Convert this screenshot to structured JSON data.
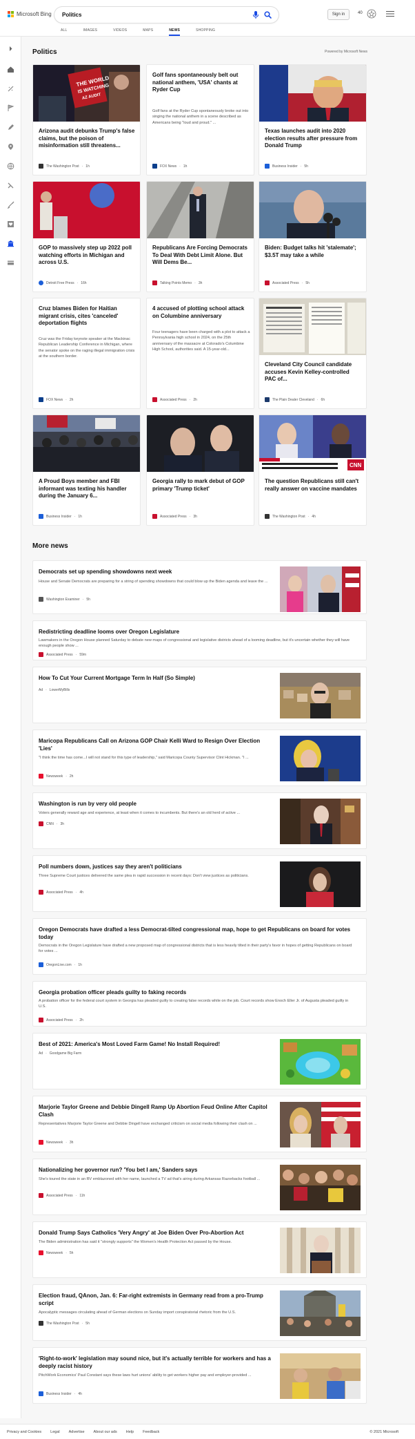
{
  "header": {
    "logo_text": "Microsoft Bing",
    "search_query": "Politics",
    "signin_label": "Sign in",
    "points": "40",
    "tabs": [
      "ALL",
      "IMAGES",
      "VIDEOS",
      "MAPS",
      "NEWS",
      "SHOPPING"
    ],
    "active_tab": "NEWS",
    "brand_colors": [
      "#f25022",
      "#7fba00",
      "#00a4ef",
      "#ffb900"
    ],
    "accent": "#174ae4"
  },
  "politics": {
    "title": "Politics",
    "powered_by": "Powered by Microsoft News",
    "cards": [
      {
        "title": "Arizona audit debunks Trump's false claims, but the poison of misinformation still threatens...",
        "source": "The Washington Post",
        "time": "1h",
        "summary": "",
        "image": "protest-sign"
      },
      {
        "title": "Golf fans spontaneously belt out national anthem, 'USA' chants at Ryder Cup",
        "source": "FOX News",
        "time": "1h",
        "summary": "Golf fans at the Ryder Cup spontaneously broke out into singing the national anthem in a scene described as Americans being \"loud and proud.\" ...",
        "image": ""
      },
      {
        "title": "Texas launches audit into 2020 election results after pressure from Donald Trump",
        "source": "Business Insider",
        "time": "5h",
        "summary": "",
        "image": "trump-flag"
      },
      {
        "title": "GOP to massively step up 2022 poll watching efforts in Michigan and across U.S.",
        "source": "Detroit Free Press",
        "time": "16h",
        "summary": "",
        "image": "podium-red"
      },
      {
        "title": "Republicans Are Forcing Democrats To Deal With Debt Limit Alone. But Will Dems Be...",
        "source": "Talking Points Memo",
        "time": "3h",
        "summary": "",
        "image": "escalator"
      },
      {
        "title": "Biden: Budget talks hit 'stalemate'; $3.5T may take a while",
        "source": "Associated Press",
        "time": "5h",
        "summary": "",
        "image": "biden-mic"
      },
      {
        "title": "Cruz blames Biden for Haitian migrant crisis, cites 'canceled' deportation flights",
        "source": "FOX News",
        "time": "2h",
        "summary": "Cruz was the Friday keynote speaker at the Mackinac Republican Leadership Conference in Michigan, where the senator spoke on the raging illegal immigration crisis at the southern border.",
        "image": ""
      },
      {
        "title": "4 accused of plotting school attack on Columbine anniversary",
        "source": "Associated Press",
        "time": "2h",
        "summary": "Four teenagers have been charged with a plot to attack a Pennsylvania high school in 2024, on the 25th anniversary of the massacre at Colorado's Columbine High School, authorities said. A 15-year-old...",
        "image": ""
      },
      {
        "title": "Cleveland City Council candidate accuses Kevin Kelley-controlled PAC of...",
        "source": "The Plain Dealer Cleveland",
        "time": "6h",
        "summary": "",
        "image": "document"
      },
      {
        "title": "A Proud Boys member and FBI informant was texting his handler during the January 6...",
        "source": "Business Insider",
        "time": "1h",
        "summary": "",
        "image": "crowd"
      },
      {
        "title": "Georgia rally to mark debut of GOP primary 'Trump ticket'",
        "source": "Associated Press",
        "time": "3h",
        "summary": "",
        "image": "two-men"
      },
      {
        "title": "The question Republicans still can't really answer on vaccine mandates",
        "source": "The Washington Post",
        "time": "4h",
        "summary": "",
        "image": "cnn"
      }
    ]
  },
  "more_news": {
    "title": "More news",
    "items": [
      {
        "title": "Democrats set up spending showdowns next week",
        "summary": "House and Senate Democrats are preparing for a string of spending showdowns that could blow up the Biden agenda and leave the ...",
        "source": "Washington Examiner",
        "time": "5h"
      },
      {
        "title": "Redistricting deadline looms over Oregon Legislature",
        "summary": "Lawmakers in the Oregon House planned Saturday to debate new maps of congressional and legislative districts ahead of a looming deadline, but it's uncertain whether they will have enough people show ...",
        "source": "Associated Press",
        "time": "59m"
      },
      {
        "title": "How To Cut Your Current Mortgage Term In Half (So Simple)",
        "summary": "",
        "source": "LowerMyBills",
        "time": "",
        "ad": "Ad"
      },
      {
        "title": "Maricopa Republicans Call on Arizona GOP Chair Kelli Ward to Resign Over Election 'Lies'",
        "summary": "\"I think the time has come...I will not stand for this type of leadership,\" said Maricopa County Supervisor Clint Hickman. \"I ...",
        "source": "Newsweek",
        "time": "2h"
      },
      {
        "title": "Washington is run by very old people",
        "summary": "Voters generally reward age and experience, at least when it comes to incumbents. But there's an old herd of active ...",
        "source": "CNN",
        "time": "3h"
      },
      {
        "title": "Poll numbers down, justices say they aren't politicians",
        "summary": "Three Supreme Court justices delivered the same plea in rapid succession in recent days: Don't view justices as politicians.",
        "source": "Associated Press",
        "time": "4h"
      },
      {
        "title": "Oregon Democrats have drafted a less Democrat-tilted congressional map, hope to get Republicans on board for votes today",
        "summary": "Democrats in the Oregon Legislature have drafted a new proposed map of congressional districts that is less heavily tilted in their party's favor in hopes of getting Republicans on board for votes ...",
        "source": "OregonLive.com",
        "time": "1h"
      },
      {
        "title": "Georgia probation officer pleads guilty to faking records",
        "summary": "A probation officer for the federal court system in Georgia has pleaded guilty to creating false records while on the job. Court records show Enoch Eller Jr. of Augusta pleaded guilty in U.S.",
        "source": "Associated Press",
        "time": "2h"
      },
      {
        "title": "Best of 2021: America's Most Loved Farm Game! No Install Required!",
        "summary": "",
        "source": "Goodgame Big Farm",
        "time": "",
        "ad": "Ad"
      },
      {
        "title": "Marjorie Taylor Greene and Debbie Dingell Ramp Up Abortion Feud Online After Capitol Clash",
        "summary": "Representatives Marjorie Taylor Greene and Debbie Dingell have exchanged criticism on social media following their clash on ...",
        "source": "Newsweek",
        "time": "3h"
      },
      {
        "title": "Nationalizing her governor run? 'You bet I am,' Sanders says",
        "summary": "She's toured the state in an RV emblazoned with her name, launched a TV ad that's airing during Arkansas Razorbacks football ...",
        "source": "Associated Press",
        "time": "11h"
      },
      {
        "title": "Donald Trump Says Catholics 'Very Angry' at Joe Biden Over Pro-Abortion Act",
        "summary": "The Biden administration has said it \"strongly supports\" the Women's Health Protection Act passed by the House.",
        "source": "Newsweek",
        "time": "5h"
      },
      {
        "title": "Election fraud, QAnon, Jan. 6: Far-right extremists in Germany read from a pro-Trump script",
        "summary": "Apocalyptic messages circulating ahead of German elections on Sunday import conspiratorial rhetoric from the U.S.",
        "source": "The Washington Post",
        "time": "5h"
      },
      {
        "title": "'Right-to-work' legislation may sound nice, but it's actually terrible for workers and has a deeply racist history",
        "summary": "PitchWork Economics' Paul Constant says these laws hurt unions' ability to get workers higher pay and employer-provided ...",
        "source": "Business Insider",
        "time": "4h"
      }
    ]
  },
  "footer": {
    "links": [
      "Privacy and Cookies",
      "Legal",
      "Advertise",
      "About our ads",
      "Help",
      "Feedback"
    ],
    "copyright": "© 2021 Microsoft"
  }
}
